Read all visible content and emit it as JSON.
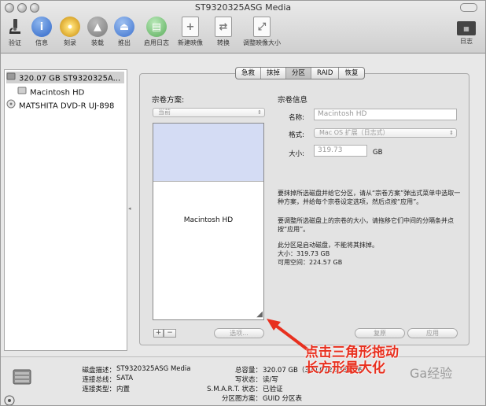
{
  "window": {
    "title": "ST9320325ASG Media",
    "color_accent": "#e8301f"
  },
  "toolbar": [
    {
      "name": "verify",
      "label": "验证",
      "icon": "microscope-icon"
    },
    {
      "name": "info",
      "label": "信息",
      "icon": "info-icon"
    },
    {
      "name": "burn",
      "label": "刻录",
      "icon": "burn-disc-icon"
    },
    {
      "name": "mount",
      "label": "装载",
      "icon": "mount-icon"
    },
    {
      "name": "eject",
      "label": "推出",
      "icon": "eject-icon"
    },
    {
      "name": "enable-journaling",
      "label": "启用日志",
      "icon": "journal-icon"
    },
    {
      "name": "new-image",
      "label": "新建映像",
      "icon": "new-image-icon"
    },
    {
      "name": "convert",
      "label": "转换",
      "icon": "convert-icon"
    },
    {
      "name": "resize-image",
      "label": "调整映像大小",
      "icon": "resize-image-icon"
    },
    {
      "name": "log",
      "label": "日志",
      "icon": "log-icon"
    }
  ],
  "sidebar": {
    "items": [
      {
        "label": "320.07 GB ST9320325A...",
        "icon": "hard-disk-icon"
      },
      {
        "label": "Macintosh HD",
        "icon": "volume-icon"
      },
      {
        "label": "MATSHITA DVD-R UJ-898",
        "icon": "optical-drive-icon"
      }
    ]
  },
  "tabs": [
    {
      "label": "急救",
      "active": false
    },
    {
      "label": "抹掉",
      "active": false
    },
    {
      "label": "分区",
      "active": true
    },
    {
      "label": "RAID",
      "active": false
    },
    {
      "label": "恢复",
      "active": false
    }
  ],
  "partition": {
    "scheme_label": "宗卷方案:",
    "scheme_value": "当前",
    "volume_name": "Macintosh HD",
    "add": "+",
    "remove": "−",
    "options": "选项...",
    "revert": "复原",
    "apply": "应用"
  },
  "volume_info": {
    "title": "宗卷信息",
    "name_label": "名称:",
    "name_value": "Macintosh HD",
    "format_label": "格式:",
    "format_value": "Mac OS 扩展（日志式）",
    "size_label": "大小:",
    "size_value": "319.73",
    "size_unit": "GB"
  },
  "hint": {
    "p1": "要抹掉所选磁盘并给它分区，请从“宗卷方案”弹出式菜单中选取一种方案，并给每个宗卷设定选项，然后点按“应用”。",
    "p2": "要调整所选磁盘上的宗卷的大小，请拖移它们中间的分隔条并点按“应用”。",
    "p3": "此分区是启动磁盘，不能将其抹掉。",
    "p4": "大小：319.73 GB",
    "p5": "可用空间：224.57 GB"
  },
  "bottom": {
    "disk_desc_label": "磁盘描述：",
    "disk_desc": "ST9320325ASG Media",
    "bus_label": "连接总线：",
    "bus": "SATA",
    "conn_type_label": "连接类型：",
    "conn_type": "内置",
    "capacity_label": "总容量：",
    "capacity": "320.07 GB（320,072,933,376",
    "write_label": "写状态：",
    "write": "读/写",
    "smart_label": "S.M.A.R.T. 状态：",
    "smart": "已验证",
    "map_label": "分区图方案：",
    "map": "GUID 分区表"
  },
  "annotation": {
    "line1": "点击三角形拖动",
    "line2": "长方形最大化"
  },
  "watermark": "Ga经验"
}
